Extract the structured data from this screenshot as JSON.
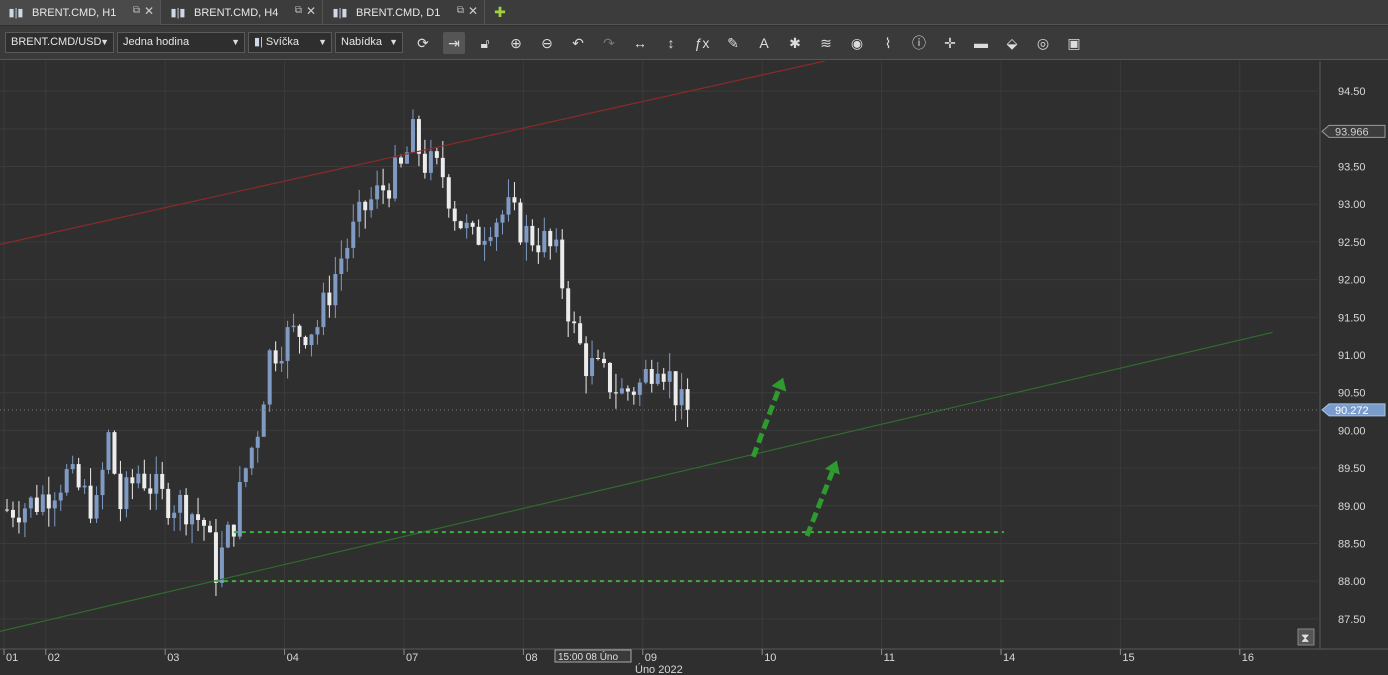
{
  "tabs": [
    {
      "label": "BRENT.CMD, H1",
      "active": true
    },
    {
      "label": "BRENT.CMD, H4",
      "active": false
    },
    {
      "label": "BRENT.CMD, D1",
      "active": false
    }
  ],
  "toolbar": {
    "instrument": "BRENT.CMD/USD",
    "period": "Jedna hodina",
    "chart_type": "Svíčka",
    "price_side": "Nabídka",
    "tools": [
      "refresh-icon",
      "autoshift-icon",
      "lock-icon",
      "zoom-in-icon",
      "zoom-out-icon",
      "undo-icon",
      "redo-icon",
      "horizontal-resize-icon",
      "vertical-resize-icon",
      "indicator-fx-icon",
      "pencil-icon",
      "text-icon",
      "pattern-icon",
      "layers-icon",
      "eye-icon",
      "alert-icon",
      "info-icon",
      "crosshair-icon",
      "period-separator-icon",
      "fill-icon",
      "settings-circle-icon",
      "save-icon"
    ]
  },
  "chart_data": {
    "type": "candlestick",
    "title": "",
    "ylim": [
      87.1,
      94.9
    ],
    "y_ticks": [
      "94.50",
      "94.00",
      "93.50",
      "93.00",
      "92.50",
      "92.00",
      "91.50",
      "91.00",
      "90.50",
      "90.00",
      "89.50",
      "89.00",
      "88.50",
      "88.00",
      "87.50"
    ],
    "y_tick_values": [
      94.5,
      94.0,
      93.5,
      93.0,
      92.5,
      92.0,
      91.5,
      91.0,
      90.5,
      90.0,
      89.5,
      89.0,
      88.5,
      88.0,
      87.5
    ],
    "x_ticks": [
      "01",
      "02",
      "03",
      "04",
      "07",
      "08",
      "09",
      "10",
      "11",
      "14",
      "15",
      "16"
    ],
    "x_tick_index": [
      0,
      7,
      27,
      47,
      67,
      87,
      107,
      127,
      147,
      167,
      187,
      207
    ],
    "x_cursor_label": "15:00 08 Úno",
    "x_period_label": "Úno 2022",
    "last_price_label": "90.272",
    "last_price": 90.272,
    "high_marker_label": "93.966",
    "high_marker": 93.966,
    "candle_count": 115,
    "key_closes": [
      [
        0,
        88.95
      ],
      [
        5,
        89.05
      ],
      [
        10,
        89.4
      ],
      [
        15,
        88.95
      ],
      [
        17,
        89.9
      ],
      [
        19,
        89.0
      ],
      [
        22,
        89.45
      ],
      [
        26,
        89.1
      ],
      [
        30,
        89.0
      ],
      [
        33,
        88.75
      ],
      [
        35,
        88.15
      ],
      [
        38,
        88.8
      ],
      [
        40,
        89.5
      ],
      [
        42,
        90.05
      ],
      [
        44,
        91.0
      ],
      [
        47,
        91.25
      ],
      [
        52,
        91.4
      ],
      [
        56,
        92.3
      ],
      [
        60,
        92.95
      ],
      [
        64,
        93.3
      ],
      [
        66,
        93.45
      ],
      [
        68,
        93.9
      ],
      [
        70,
        93.55
      ],
      [
        73,
        93.4
      ],
      [
        75,
        92.9
      ],
      [
        78,
        92.5
      ],
      [
        81,
        92.8
      ],
      [
        84,
        92.9
      ],
      [
        87,
        92.6
      ],
      [
        90,
        92.5
      ],
      [
        92,
        92.3
      ],
      [
        95,
        91.3
      ],
      [
        97,
        90.9
      ],
      [
        100,
        90.7
      ],
      [
        103,
        90.5
      ],
      [
        106,
        90.6
      ],
      [
        109,
        91.0
      ],
      [
        111,
        90.7
      ],
      [
        113,
        90.3
      ],
      [
        114,
        90.272
      ]
    ],
    "lines": [
      {
        "name": "resistance",
        "color": "#8a2a2a",
        "from": [
          -5,
          92.4
        ],
        "to": [
          137,
          94.9
        ]
      },
      {
        "name": "trendline",
        "color": "#2f6b2f",
        "from": [
          -3,
          87.3
        ],
        "to": [
          212,
          91.3
        ]
      }
    ],
    "support_lines": [
      {
        "value": 88.65,
        "color": "#3fae3f",
        "from_index": 38,
        "to_index": 167
      },
      {
        "value": 88.0,
        "color": "#3fae3f",
        "from_index": 35,
        "to_index": 167
      }
    ],
    "arrows": [
      {
        "from": [
          125,
          89.65
        ],
        "to": [
          130,
          90.7
        ],
        "color": "#2f9a2f"
      },
      {
        "from": [
          134,
          88.6
        ],
        "to": [
          139,
          89.6
        ],
        "color": "#2f9a2f"
      }
    ],
    "colors": {
      "bull": "#7f9bc4",
      "bear": "#ececec",
      "background": "#2f2f2f",
      "grid": "#3b3b3b"
    }
  }
}
